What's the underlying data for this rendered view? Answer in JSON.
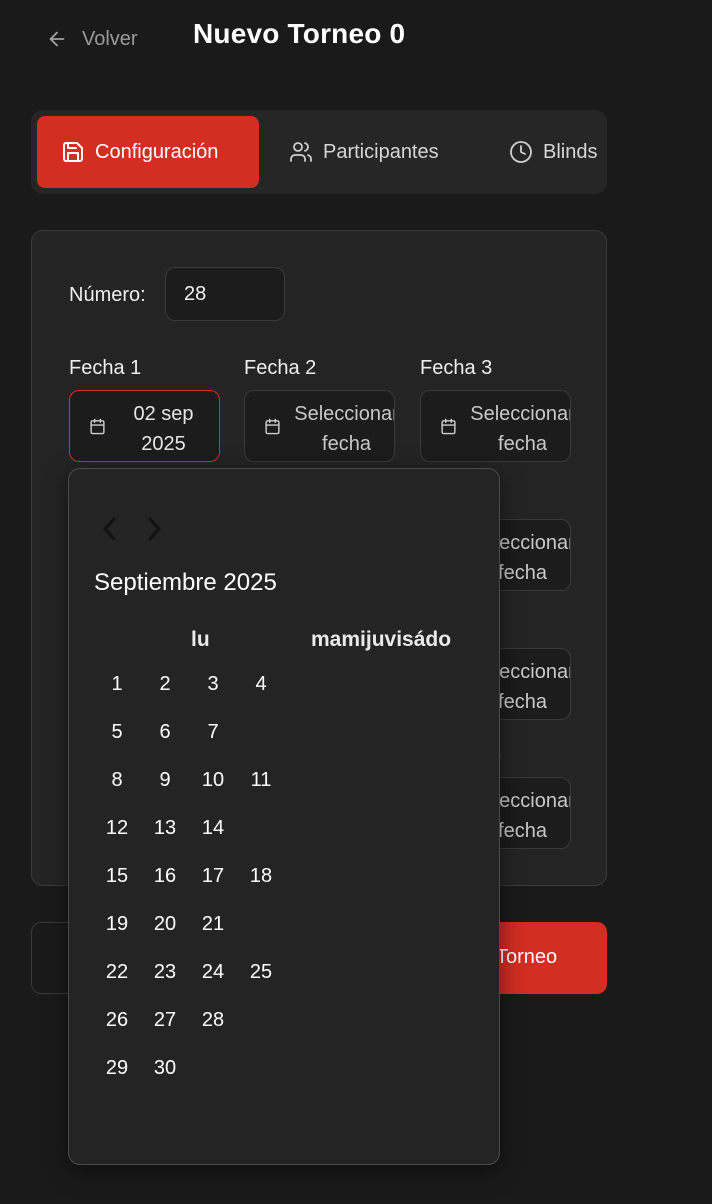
{
  "header": {
    "back_label": "Volver",
    "title": "Nuevo Torneo 0"
  },
  "tabs": [
    {
      "label": "Configuración",
      "icon": "save-icon",
      "active": true
    },
    {
      "label": "Participantes",
      "icon": "users-icon",
      "active": false
    },
    {
      "label": "Blinds",
      "icon": "clock-icon",
      "active": false
    }
  ],
  "form": {
    "numero_label": "Número:",
    "numero_value": "28",
    "fechas": [
      {
        "label": "Fecha 1",
        "line1": "02 sep",
        "line2": "2025",
        "selected": true
      },
      {
        "label": "Fecha 2",
        "line1": "Seleccionar",
        "line2": "fecha",
        "selected": false
      },
      {
        "label": "Fecha 3",
        "line1": "Seleccionar",
        "line2": "fecha",
        "selected": false
      },
      {
        "label": "",
        "line1": "Seleccionar",
        "line2": "fecha",
        "selected": false
      },
      {
        "label": "",
        "line1": "Seleccionar",
        "line2": "fecha",
        "selected": false
      },
      {
        "label": "",
        "line1": "Seleccionar",
        "line2": "fecha",
        "selected": false
      }
    ],
    "partial_label": "2"
  },
  "actions": {
    "cancel_label": "",
    "create_label": "Torneo"
  },
  "calendar": {
    "caption": "Septiembre 2025",
    "weekday_lu": "lu",
    "weekday_rest": "mamijuvisádo",
    "days": [
      "1",
      "2",
      "3",
      "4",
      "5",
      "6",
      "7",
      "8",
      "9",
      "10",
      "11",
      "12",
      "13",
      "14",
      "15",
      "16",
      "17",
      "18",
      "19",
      "20",
      "21",
      "22",
      "23",
      "24",
      "25",
      "26",
      "27",
      "28",
      "29",
      "30"
    ]
  },
  "colors": {
    "accent": "#d22e22",
    "background": "#1a1a1a",
    "surface": "#242424"
  }
}
